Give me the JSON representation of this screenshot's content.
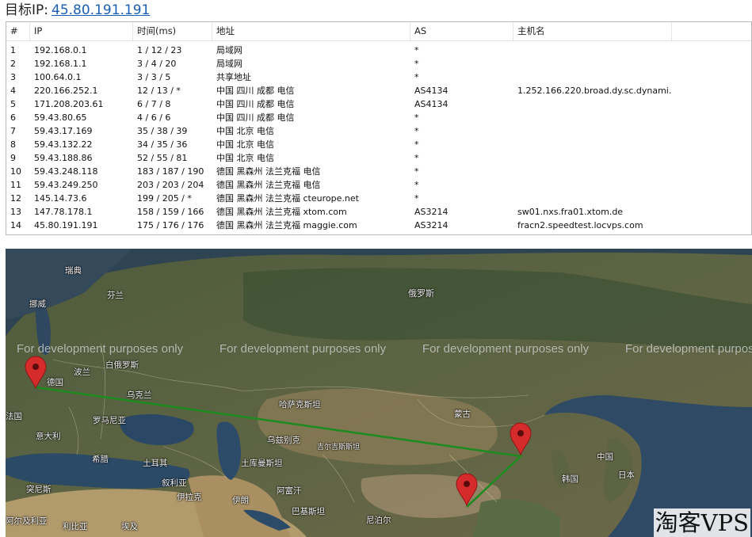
{
  "header": {
    "label": "目标IP:",
    "target_ip": "45.80.191.191"
  },
  "table": {
    "columns": [
      "#",
      "IP",
      "时间(ms)",
      "地址",
      "AS",
      "主机名"
    ],
    "rows": [
      [
        "1",
        "192.168.0.1",
        "1 / 12 / 23",
        "局域网",
        "*",
        ""
      ],
      [
        "2",
        "192.168.1.1",
        "3 / 4 / 20",
        "局域网",
        "*",
        ""
      ],
      [
        "3",
        "100.64.0.1",
        "3 / 3 / 5",
        "共享地址",
        "*",
        ""
      ],
      [
        "4",
        "220.166.252.1",
        "12 / 13 / *",
        "中国 四川 成都 电信",
        "AS4134",
        "1.252.166.220.broad.dy.sc.dynami..."
      ],
      [
        "5",
        "171.208.203.61",
        "6 / 7 / 8",
        "中国 四川 成都 电信",
        "AS4134",
        ""
      ],
      [
        "6",
        "59.43.80.65",
        "4 / 6 / 6",
        "中国 四川 成都 电信",
        "*",
        ""
      ],
      [
        "7",
        "59.43.17.169",
        "35 / 38 / 39",
        "中国 北京 电信",
        "*",
        ""
      ],
      [
        "8",
        "59.43.132.22",
        "34 / 35 / 36",
        "中国 北京 电信",
        "*",
        ""
      ],
      [
        "9",
        "59.43.188.86",
        "52 / 55 / 81",
        "中国 北京 电信",
        "*",
        ""
      ],
      [
        "10",
        "59.43.248.118",
        "183 / 187 / 190",
        "德国 黑森州 法兰克福 电信",
        "*",
        ""
      ],
      [
        "11",
        "59.43.249.250",
        "203 / 203 / 204",
        "德国 黑森州 法兰克福 电信",
        "*",
        ""
      ],
      [
        "12",
        "145.14.73.6",
        "199 / 205 / *",
        "德国 黑森州 法兰克福 cteurope.net",
        "*",
        ""
      ],
      [
        "13",
        "147.78.178.1",
        "158 / 159 / 166",
        "德国 黑森州 法兰克福 xtom.com",
        "AS3214",
        "sw01.nxs.fra01.xtom.de"
      ],
      [
        "14",
        "45.80.191.191",
        "175 / 176 / 176",
        "德国 黑森州 法兰克福 maggie.com",
        "AS3214",
        "fracn2.speedtest.locvps.com"
      ]
    ]
  },
  "map": {
    "dev_text": "For development purposes only",
    "labels": [
      "瑞典",
      "芬兰",
      "挪威",
      "白俄罗斯",
      "波兰",
      "乌克兰",
      "罗马尼亚",
      "意大利",
      "希腊",
      "土耳其",
      "德国",
      "法国",
      "俄罗斯",
      "哈萨克斯坦",
      "乌兹别克",
      "土库曼斯坦",
      "阿富汗",
      "伊朗",
      "伊拉克",
      "叙利亚",
      "巴基斯坦",
      "埃及",
      "利比亚",
      "阿尔及利亚",
      "突尼斯",
      "蒙古",
      "中国",
      "日本",
      "韩国",
      "尼泊尔",
      "吉尔吉斯斯坦"
    ],
    "route_color": "#1f8a1f",
    "marker_color": "#d62b2b"
  },
  "watermark": "淘客VPS"
}
